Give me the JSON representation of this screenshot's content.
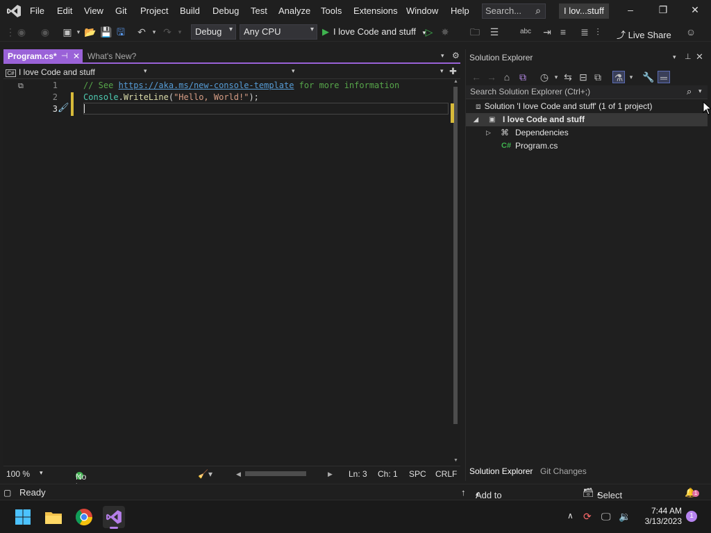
{
  "menubar": {
    "items": [
      "File",
      "Edit",
      "View",
      "Git",
      "Project",
      "Build",
      "Debug",
      "Test",
      "Analyze",
      "Tools",
      "Extensions",
      "Window",
      "Help"
    ],
    "search_placeholder": "Search...",
    "solution_short": "I lov...stuff"
  },
  "toolbar": {
    "configuration": "Debug",
    "platform": "Any CPU",
    "run_target": "I love Code and stuff",
    "live_share": "Live Share"
  },
  "editor": {
    "tabs": [
      {
        "label": "Program.cs*",
        "active": true
      },
      {
        "label": "What's New?",
        "active": false
      }
    ],
    "nav_project": "I love Code and stuff",
    "nav_badge": "C#",
    "lines": [
      {
        "number": "1",
        "comment_prefix": "// See ",
        "link": "https://aka.ms/new-console-template",
        "comment_suffix": " for more information"
      },
      {
        "number": "2",
        "type": "Console",
        "dot": ".",
        "method": "WriteLine",
        "open": "(",
        "string": "\"Hello, World!\"",
        "close": ");"
      },
      {
        "number": "3"
      }
    ],
    "status": {
      "zoom": "100 %",
      "issues": "No issues found",
      "line": "Ln: 3",
      "char": "Ch: 1",
      "whitespace": "SPC",
      "line_ending": "CRLF"
    }
  },
  "solution_explorer": {
    "title": "Solution Explorer",
    "search_placeholder": "Search Solution Explorer (Ctrl+;)",
    "tree": {
      "solution": "Solution 'I love Code and stuff' (1 of 1 project)",
      "project": "I love Code and stuff",
      "dependencies": "Dependencies",
      "file": "Program.cs"
    },
    "bottom_tabs": [
      "Solution Explorer",
      "Git Changes"
    ]
  },
  "app_status": {
    "state": "Ready",
    "source_control": "Add to Source Control",
    "repository": "Select Repository",
    "notifications": "1"
  },
  "taskbar": {
    "time": "7:44 AM",
    "date": "3/13/2023",
    "notification_count": "1"
  },
  "colors": {
    "accent": "#9a62d8",
    "run_green": "#3fb34f",
    "change_marker": "#d7ba3a"
  }
}
